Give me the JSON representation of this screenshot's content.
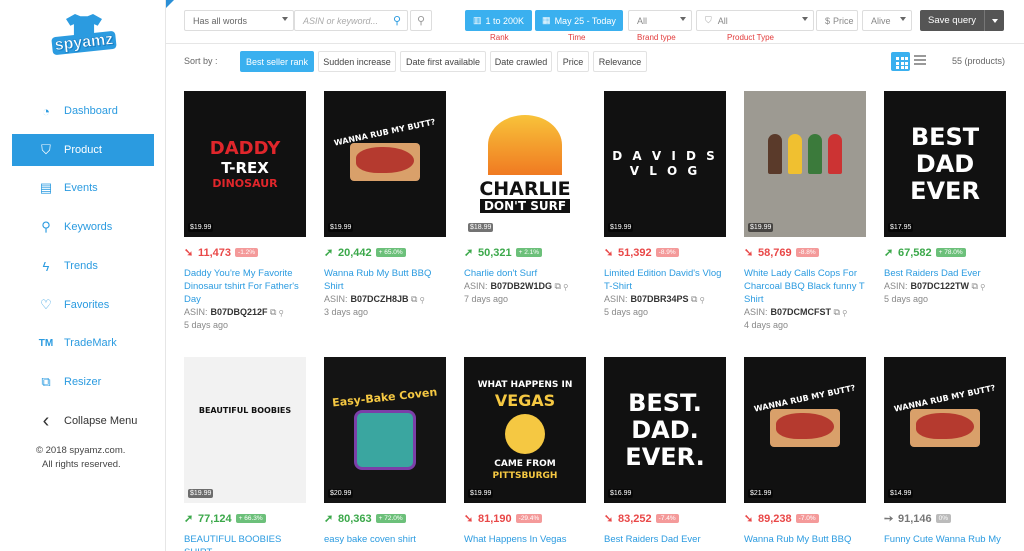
{
  "brand": {
    "logo_text": "spyamz"
  },
  "sidebar": {
    "items": [
      {
        "label": "Dashboard",
        "icon": "pie-chart-icon",
        "glyph": "◔"
      },
      {
        "label": "Product",
        "icon": "tshirt-icon",
        "glyph": "⛉"
      },
      {
        "label": "Events",
        "icon": "calendar-icon",
        "glyph": "▤"
      },
      {
        "label": "Keywords",
        "icon": "magnifier-icon",
        "glyph": "⚲"
      },
      {
        "label": "Trends",
        "icon": "lightning-icon",
        "glyph": "ϟ"
      },
      {
        "label": "Favorites",
        "icon": "heart-icon",
        "glyph": "♡"
      },
      {
        "label": "TradeMark",
        "icon": "trademark-icon",
        "glyph": "TM"
      },
      {
        "label": "Resizer",
        "icon": "resize-icon",
        "glyph": "⧉"
      },
      {
        "label": "Collapse Menu",
        "icon": "chevron-left-icon",
        "glyph": "‹"
      }
    ],
    "copyright_line1": "© 2018 spyamz.com.",
    "copyright_line2": "All rights reserved."
  },
  "filters": {
    "search_mode": "Has all words",
    "search_placeholder": "ASIN or keyword...",
    "rank_button": "1 to 200K",
    "rank_label": "Rank",
    "time_button": "May 25 - Today",
    "time_label": "Time",
    "brand_type_value": "All",
    "brand_type_label": "Brand type",
    "product_type_value": "All",
    "product_type_label": "Product Type",
    "price_label": "Price",
    "price_prefix": "$",
    "status_value": "Alive",
    "save_query": "Save query"
  },
  "sort": {
    "label": "Sort by :",
    "options": [
      "Best seller rank",
      "Sudden increase",
      "Date first available",
      "Date crawled",
      "Price",
      "Relevance"
    ],
    "active": "Best seller rank",
    "count": "55 (products)"
  },
  "products": [
    {
      "price": "$19.99",
      "trend": "down",
      "arrow": "➘",
      "rank": "11,473",
      "change": "-1.2%",
      "title": "Daddy You're My Favorite Dinosaur tshirt For Father's Day",
      "asin": "B07DBQ212F",
      "ago": "5 days ago",
      "art": "DADDY\nT-REX\nDINOSAUR"
    },
    {
      "price": "$19.99",
      "trend": "up",
      "arrow": "➚",
      "rank": "20,442",
      "change": "+ 65.0%",
      "title": "Wanna Rub My Butt BBQ Shirt",
      "asin": "B07DCZH8JB",
      "ago": "3 days ago",
      "art": "WANNA RUB MY BUTT?"
    },
    {
      "price": "$18.99",
      "trend": "up",
      "arrow": "➚",
      "rank": "50,321",
      "change": "+ 2.1%",
      "title": "Charlie don't Surf",
      "asin": "B07DB2W1DG",
      "ago": "7 days ago",
      "art": "CHARLIE\nDON'T SURF"
    },
    {
      "price": "$19.99",
      "trend": "down",
      "arrow": "➘",
      "rank": "51,392",
      "change": "-8.9%",
      "title": "Limited Edition David's Vlog T-Shirt",
      "asin": "B07DBR34PS",
      "ago": "5 days ago",
      "art": "D A V I D S\nV L O G"
    },
    {
      "price": "$19.99",
      "trend": "down",
      "arrow": "➘",
      "rank": "58,769",
      "change": "-8.8%",
      "title": "White Lady Calls Cops For Charcoal BBQ Black funny T Shirt",
      "asin": "B07DCMCFST",
      "ago": "4 days ago",
      "art": ""
    },
    {
      "price": "$17.95",
      "trend": "up",
      "arrow": "➚",
      "rank": "67,582",
      "change": "+ 78.0%",
      "title": "Best Raiders Dad Ever",
      "asin": "B07DC122TW",
      "ago": "5 days ago",
      "art": "BEST\nDAD\nEVER"
    },
    {
      "price": "$19.99",
      "trend": "up",
      "arrow": "➚",
      "rank": "77,124",
      "change": "+ 66.3%",
      "title": "BEAUTIFUL BOOBIES SHIRT",
      "asin": "",
      "ago": "",
      "art": "BEAUTIFUL BOOBIES"
    },
    {
      "price": "$20.99",
      "trend": "up",
      "arrow": "➚",
      "rank": "80,363",
      "change": "+ 72.0%",
      "title": "easy bake coven shirt",
      "asin": "",
      "ago": "",
      "art": "Easy-Bake Coven"
    },
    {
      "price": "$19.99",
      "trend": "down",
      "arrow": "➘",
      "rank": "81,190",
      "change": "-29.4%",
      "title": "What Happens In Vegas",
      "asin": "",
      "ago": "",
      "art": "WHAT HAPPENS IN\nVEGAS\nCAME FROM\nPITTSBURGH"
    },
    {
      "price": "$16.99",
      "trend": "down",
      "arrow": "➘",
      "rank": "83,252",
      "change": "-7.4%",
      "title": "Best Raiders Dad Ever",
      "asin": "",
      "ago": "",
      "art": "BEST.\nDAD.\nEVER."
    },
    {
      "price": "$21.99",
      "trend": "down",
      "arrow": "➘",
      "rank": "89,238",
      "change": "-7.0%",
      "title": "Wanna Rub My Butt BBQ",
      "asin": "",
      "ago": "",
      "art": "WANNA RUB MY BUTT?"
    },
    {
      "price": "$14.99",
      "trend": "flat",
      "arrow": "➙",
      "rank": "91,146",
      "change": "0%",
      "title": "Funny Cute Wanna Rub My",
      "asin": "",
      "ago": "",
      "art": "WANNA RUB MY BUTT?"
    }
  ],
  "asin_label": "ASIN:",
  "colors": {
    "accent": "#2b9be0",
    "up": "#3ba84a",
    "down": "#e94848"
  }
}
